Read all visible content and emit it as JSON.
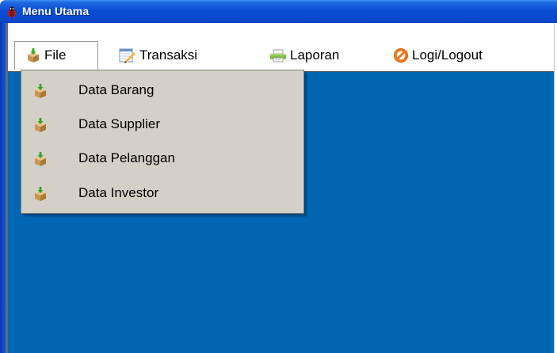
{
  "window": {
    "title": "Menu Utama",
    "app_icon": "bug-icon"
  },
  "menubar": {
    "items": [
      {
        "label": "File",
        "icon": "box-download-icon"
      },
      {
        "label": "Transaksi",
        "icon": "notepad-edit-icon"
      },
      {
        "label": "Laporan",
        "icon": "printer-icon"
      },
      {
        "label": "Logi/Logout",
        "icon": "no-entry-icon"
      }
    ]
  },
  "file_menu": {
    "items": [
      {
        "label": "Data Barang",
        "icon": "box-download-icon"
      },
      {
        "label": "Data Supplier",
        "icon": "box-download-icon"
      },
      {
        "label": "Data Pelanggan",
        "icon": "box-download-icon"
      },
      {
        "label": "Data Investor",
        "icon": "box-download-icon"
      }
    ]
  },
  "colors": {
    "titlebar": "#0a4fd4",
    "desktop": "#0066b3",
    "menu_bg": "#d4d0c8"
  }
}
